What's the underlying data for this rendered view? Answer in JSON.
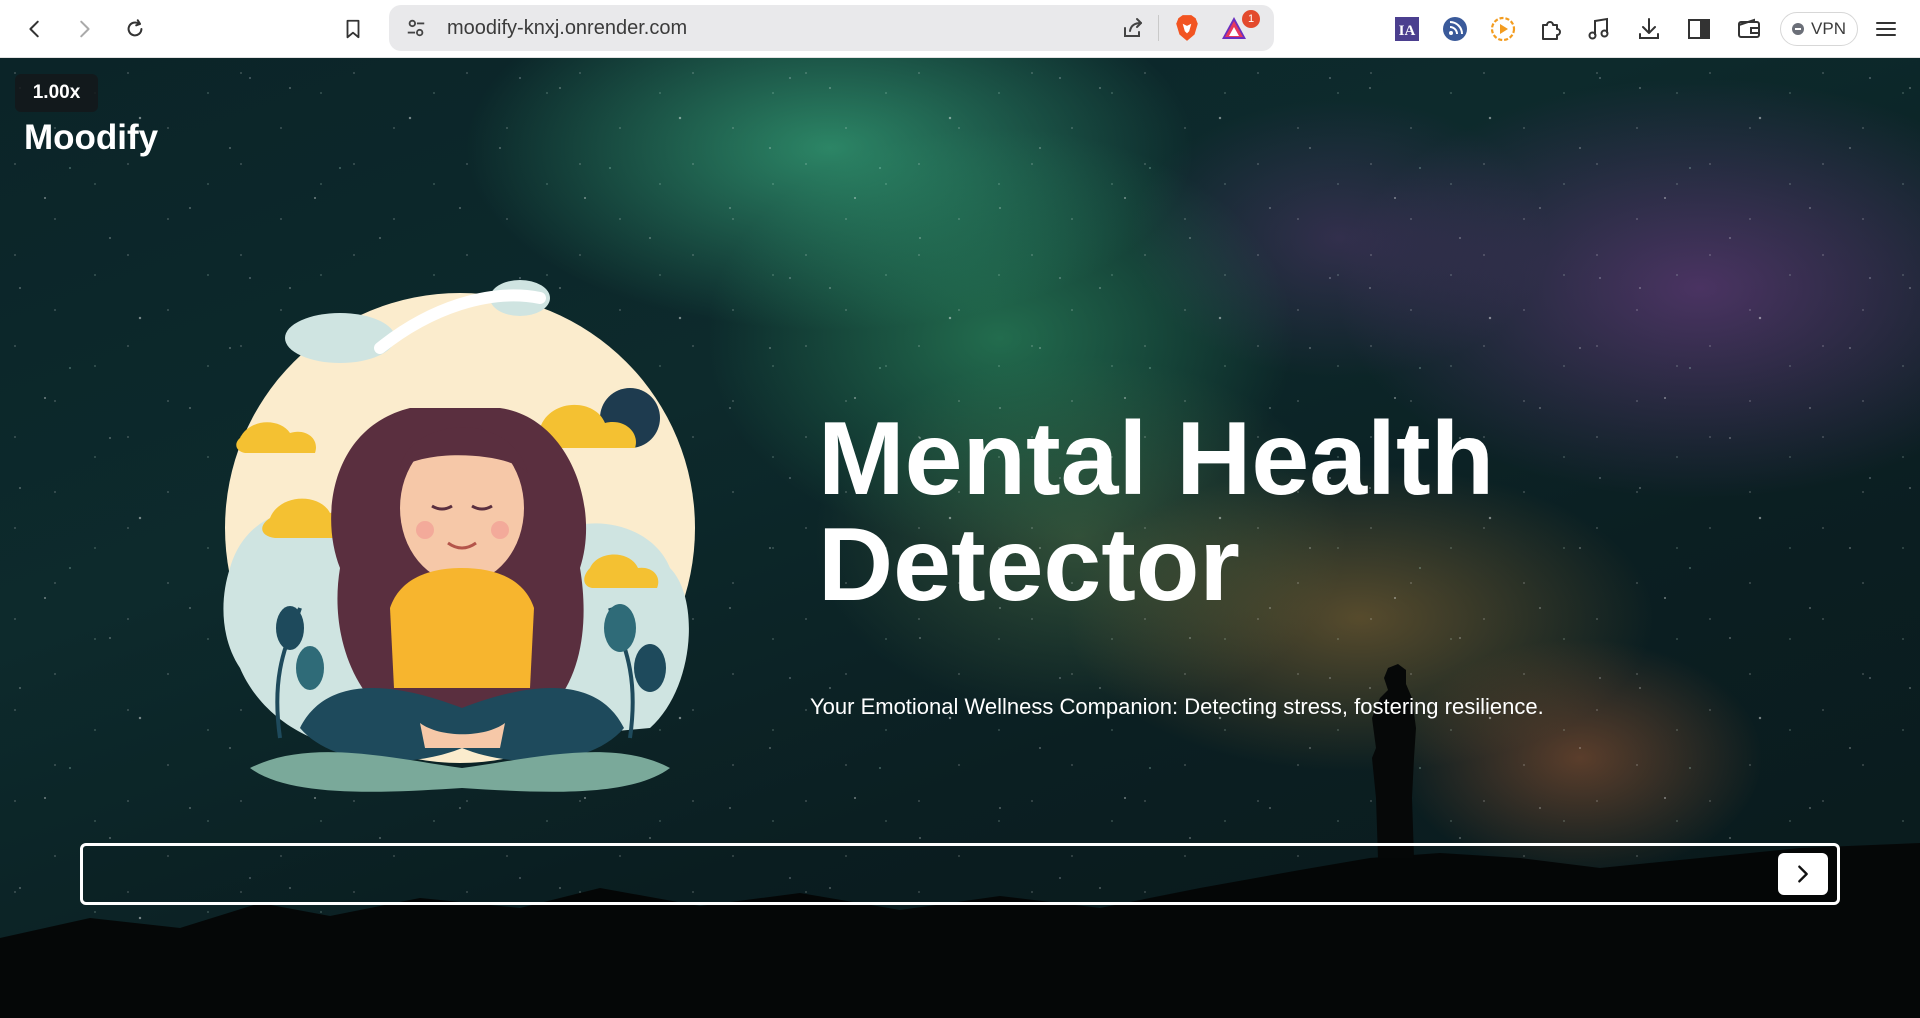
{
  "browser": {
    "url": "moodify-knxj.onrender.com",
    "rewards_badge": "1",
    "vpn_label": "VPN",
    "icons": [
      "back-arrow-icon",
      "forward-arrow-icon",
      "reload-icon",
      "bookmark-icon",
      "site-settings-icon",
      "share-icon",
      "brave-shield-icon",
      "brave-rewards-icon",
      "ia-extension-icon",
      "rss-extension-icon",
      "play-extension-icon",
      "extensions-icon",
      "music-icon",
      "download-icon",
      "sidebar-icon",
      "wallet-icon",
      "menu-icon"
    ]
  },
  "page": {
    "speed_badge": "1.00x",
    "brand": "Moodify",
    "hero": {
      "title_line1": "Mental Health",
      "title_line2": "Detector",
      "subtitle": "Your Emotional Wellness Companion: Detecting stress, fostering resilience."
    },
    "prompt": {
      "value": "",
      "placeholder": ""
    },
    "colors": {
      "background": "#0b2428",
      "accent_text": "#ffffff"
    }
  }
}
